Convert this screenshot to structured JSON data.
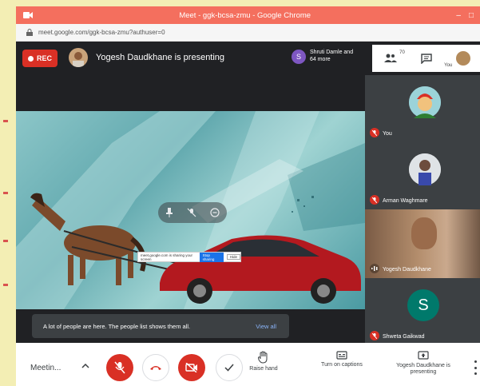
{
  "window": {
    "title": "Meet - ggk-bcsa-zmu - Google Chrome",
    "url": "meet.google.com/ggk-bcsa-zmu?authuser=0",
    "controls": [
      "–",
      "□"
    ]
  },
  "topbar": {
    "rec_label": "REC",
    "presenting_text": "Yogesh Daudkhane is presenting",
    "joined_initial": "S",
    "joined_text": "Shruti Damle and 64 more",
    "participants_count": "70",
    "you_label": "You"
  },
  "sharebar": {
    "text": "meet.google.com is sharing your screen",
    "stop_label": "Stop sharing",
    "hide_label": "Hide"
  },
  "toast": {
    "message": "A lot of people are here. The people list shows them all.",
    "action": "View all"
  },
  "participants": [
    {
      "name": "You"
    },
    {
      "name": "Arman Waghmare"
    },
    {
      "name": "Yogesh Daudkhane"
    },
    {
      "name": "Shweta Gaikwad",
      "initial": "S"
    }
  ],
  "bottombar": {
    "meeting_details": "Meetin...",
    "raise_hand": "Raise hand",
    "captions": "Turn on captions",
    "presenting": "Yogesh Daudkhane is presenting"
  },
  "colors": {
    "accent_red": "#d93025",
    "titlebar": "#f46f5e",
    "link_blue": "#8ab4f8",
    "avatar_teal": "#00796b",
    "avatar_purple": "#7e57c2"
  }
}
